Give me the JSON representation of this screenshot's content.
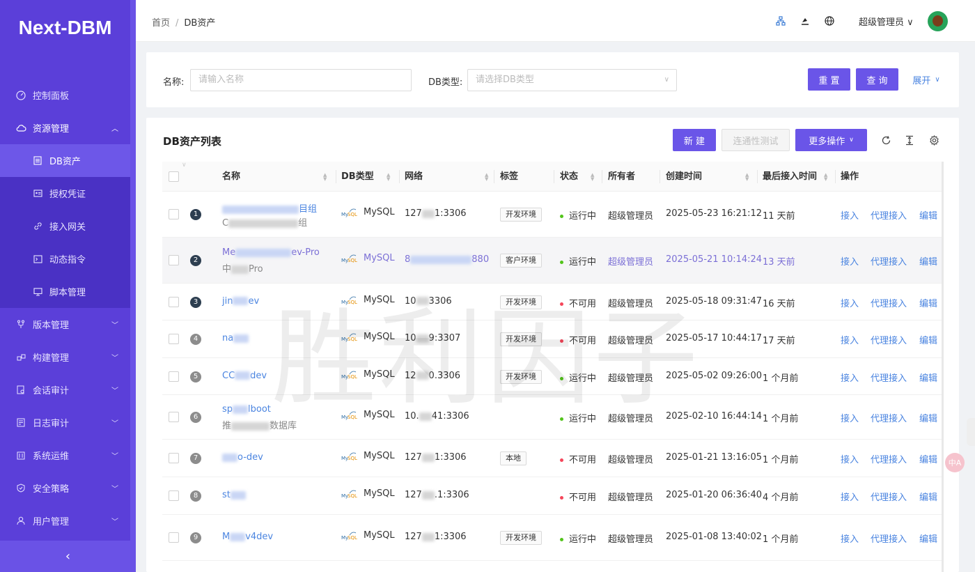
{
  "app": {
    "logo": "Next-DBM"
  },
  "sidebar": {
    "items": [
      {
        "label": "控制面板",
        "icon": "dashboard-icon"
      },
      {
        "label": "资源管理",
        "icon": "cloud-icon",
        "open": true,
        "children": [
          {
            "label": "DB资产",
            "icon": "list-icon",
            "active": true
          },
          {
            "label": "授权凭证",
            "icon": "id-card-icon"
          },
          {
            "label": "接入网关",
            "icon": "link-icon"
          },
          {
            "label": "动态指令",
            "icon": "code-icon"
          },
          {
            "label": "脚本管理",
            "icon": "monitor-icon"
          }
        ]
      },
      {
        "label": "版本管理",
        "icon": "branch-icon"
      },
      {
        "label": "构建管理",
        "icon": "build-icon"
      },
      {
        "label": "会话审计",
        "icon": "audit-icon"
      },
      {
        "label": "日志审计",
        "icon": "log-icon"
      },
      {
        "label": "系统运维",
        "icon": "ops-icon"
      },
      {
        "label": "安全策略",
        "icon": "shield-icon"
      },
      {
        "label": "用户管理",
        "icon": "user-icon"
      }
    ],
    "collapse_icon": "chevron-left-icon"
  },
  "header": {
    "breadcrumb": [
      "首页",
      "DB资产"
    ],
    "user": "超级管理员"
  },
  "search": {
    "name_label": "名称:",
    "name_placeholder": "请输入名称",
    "type_label": "DB类型:",
    "type_placeholder": "请选择DB类型",
    "reset": "重 置",
    "query": "查 询",
    "expand": "展开"
  },
  "table": {
    "title": "DB资产列表",
    "new_button": "新 建",
    "connectivity_button": "连通性测试",
    "more_button": "更多操作",
    "columns": [
      "名称",
      "DB类型",
      "网络",
      "标签",
      "状态",
      "所有者",
      "创建时间",
      "最后接入时间",
      "操作"
    ],
    "actions": [
      "接入",
      "代理接入",
      "编辑"
    ],
    "rows": [
      {
        "no": "1",
        "name_pre": "",
        "name_suf": "目组",
        "sub_pre": "C",
        "sub_suf": "组",
        "type": "MySQL",
        "net_pre": "127",
        "net_suf": "1:3306",
        "tag": "开发环境",
        "status": "运行中",
        "ok": true,
        "owner": "超级管理员",
        "created": "2025-05-23 16:21:12",
        "last": "11 天前"
      },
      {
        "no": "2",
        "name_pre": "Me",
        "name_suf": "ev-Pro",
        "sub_pre": "中",
        "sub_suf": "Pro",
        "type": "MySQL",
        "net_pre": "8",
        "net_suf": "880",
        "tag": "客户环境",
        "status": "运行中",
        "ok": true,
        "owner": "超级管理员",
        "created": "2025-05-21 10:14:24",
        "last": "13 天前"
      },
      {
        "no": "3",
        "name_pre": "jin",
        "name_suf": "ev",
        "sub_pre": "",
        "sub_suf": "",
        "type": "MySQL",
        "net_pre": "10",
        "net_suf": "3306",
        "tag": "开发环境",
        "status": "不可用",
        "ok": false,
        "owner": "超级管理员",
        "created": "2025-05-18 09:31:47",
        "last": "16 天前"
      },
      {
        "no": "4",
        "name_pre": "na",
        "name_suf": "",
        "sub_pre": "",
        "sub_suf": "",
        "type": "MySQL",
        "net_pre": "10",
        "net_suf": "9:3307",
        "tag": "开发环境",
        "status": "不可用",
        "ok": false,
        "owner": "超级管理员",
        "created": "2025-05-17 10:44:17",
        "last": "17 天前"
      },
      {
        "no": "5",
        "name_pre": "CC",
        "name_suf": "dev",
        "sub_pre": "",
        "sub_suf": "",
        "type": "MySQL",
        "net_pre": "12",
        "net_suf": "0.3306",
        "tag": "开发环境",
        "status": "运行中",
        "ok": true,
        "owner": "超级管理员",
        "created": "2025-05-02 09:26:00",
        "last": "1 个月前"
      },
      {
        "no": "6",
        "name_pre": "sp",
        "name_suf": "lboot",
        "sub_pre": "推",
        "sub_suf": "数据库",
        "type": "MySQL",
        "net_pre": "10.",
        "net_suf": "41:3306",
        "tag": "",
        "status": "运行中",
        "ok": true,
        "owner": "超级管理员",
        "created": "2025-02-10 16:44:14",
        "last": "1 个月前"
      },
      {
        "no": "7",
        "name_pre": "",
        "name_suf": "o-dev",
        "sub_pre": "",
        "sub_suf": "",
        "type": "MySQL",
        "net_pre": "127",
        "net_suf": "1:3306",
        "tag": "本地",
        "status": "不可用",
        "ok": false,
        "owner": "超级管理员",
        "created": "2025-01-21 13:16:05",
        "last": "1 个月前"
      },
      {
        "no": "8",
        "name_pre": "st",
        "name_suf": "",
        "sub_pre": "",
        "sub_suf": "",
        "type": "MySQL",
        "net_pre": "127",
        "net_suf": ".1:3306",
        "tag": "",
        "status": "不可用",
        "ok": false,
        "owner": "超级管理员",
        "created": "2025-01-20 06:36:40",
        "last": "4 个月前"
      },
      {
        "no": "9",
        "name_pre": "M",
        "name_suf": "v4dev",
        "sub_pre": "",
        "sub_suf": "",
        "type": "MySQL",
        "net_pre": "127",
        "net_suf": "1:3306",
        "tag": "开发环境",
        "status": "运行中",
        "ok": true,
        "owner": "超级管理员",
        "created": "2025-01-08 13:40:02",
        "last": "1 个月前"
      }
    ]
  },
  "watermark": "胜利因子",
  "colors": {
    "sidebar": "#5b3fd9",
    "primary": "#6a55e8",
    "link": "#4a84e0",
    "ok": "#52c41a",
    "bad": "#f5465a"
  }
}
